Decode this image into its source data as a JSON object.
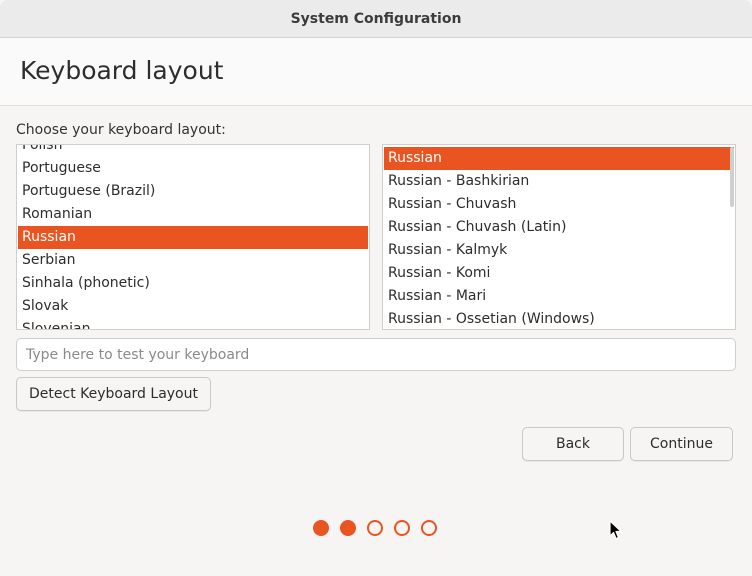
{
  "window": {
    "title": "System Configuration"
  },
  "header": {
    "title": "Keyboard layout"
  },
  "main": {
    "prompt": "Choose your keyboard layout:",
    "layouts": [
      {
        "label": "Polish",
        "selected": false
      },
      {
        "label": "Portuguese",
        "selected": false
      },
      {
        "label": "Portuguese (Brazil)",
        "selected": false
      },
      {
        "label": "Romanian",
        "selected": false
      },
      {
        "label": "Russian",
        "selected": true
      },
      {
        "label": "Serbian",
        "selected": false
      },
      {
        "label": "Sinhala (phonetic)",
        "selected": false
      },
      {
        "label": "Slovak",
        "selected": false
      },
      {
        "label": "Slovenian",
        "selected": false
      }
    ],
    "variants": [
      {
        "label": "Russian",
        "selected": true
      },
      {
        "label": "Russian - Bashkirian",
        "selected": false
      },
      {
        "label": "Russian - Chuvash",
        "selected": false
      },
      {
        "label": "Russian - Chuvash (Latin)",
        "selected": false
      },
      {
        "label": "Russian - Kalmyk",
        "selected": false
      },
      {
        "label": "Russian - Komi",
        "selected": false
      },
      {
        "label": "Russian - Mari",
        "selected": false
      },
      {
        "label": "Russian - Ossetian (Windows)",
        "selected": false
      }
    ],
    "test_input": {
      "value": "",
      "placeholder": "Type here to test your keyboard"
    },
    "detect_label": "Detect Keyboard Layout"
  },
  "footer": {
    "back_label": "Back",
    "continue_label": "Continue",
    "progress": {
      "total_steps": 5,
      "completed_steps": 2
    }
  },
  "colors": {
    "accent": "#e95420",
    "window_bg": "#f6f5f4",
    "titlebar_bg": "#ebebeb"
  },
  "icons": {
    "pointer": "mouse-pointer-icon"
  }
}
